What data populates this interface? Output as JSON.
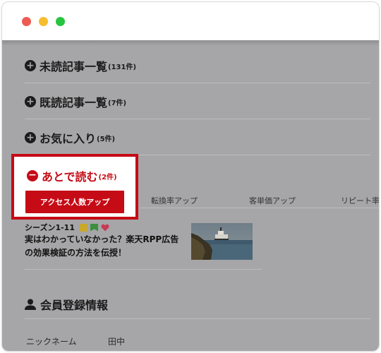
{
  "window": {
    "controls": [
      "close",
      "minimize",
      "maximize"
    ],
    "colors": {
      "close": "#ef5a52",
      "minimize": "#f7bd2e",
      "maximize": "#27c43f"
    }
  },
  "accordion": [
    {
      "title": "未読記事一覧",
      "count": "(131件)",
      "icon": "plus-circle-icon"
    },
    {
      "title": "既読記事一覧",
      "count": "(7件)",
      "icon": "plus-circle-icon"
    },
    {
      "title": "お気に入り",
      "count": "(5件)",
      "icon": "plus-circle-icon"
    }
  ],
  "read_later": {
    "title": "あとで読む",
    "count": "(2件)",
    "icon": "minus-circle-icon",
    "tabs": [
      "アクセス人数アップ",
      "転換率アップ",
      "客単価アップ",
      "リピート率アップ"
    ],
    "active_tab": "アクセス人数アップ",
    "accent_color": "#c50b16"
  },
  "article": {
    "season": "シーズン1-11",
    "tag_icons": [
      "memo-icon",
      "bookmark-icon",
      "heart-icon"
    ],
    "title_line1": "実はわかっていなかった？楽天RPP広告",
    "title_line2": "の効果検証の方法を伝授！"
  },
  "member": {
    "title": "会員登録情報",
    "icon": "person-icon",
    "nickname_label": "ニックネーム",
    "nickname_value": "田中"
  }
}
